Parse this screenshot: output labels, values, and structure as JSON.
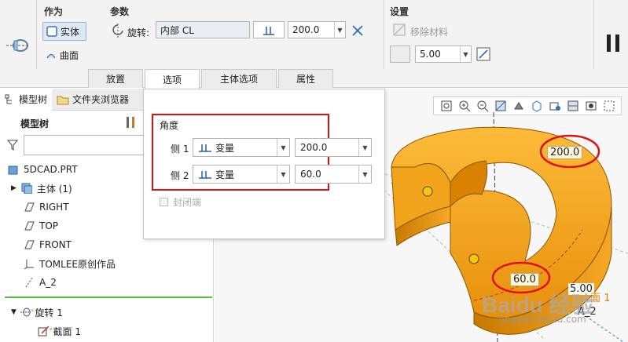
{
  "ribbon": {
    "zuowei_title": "作为",
    "shiti_label": "实体",
    "qumian_label": "曲面",
    "canshu_title": "参数",
    "xuanzhuan_label": "旋转:",
    "axis_value": "内部 CL",
    "angle_value": "200.0",
    "shezhi_title": "设置",
    "yichu_label": "移除材料",
    "thickness_value": "5.00"
  },
  "tabs": [
    "放置",
    "选项",
    "主体选项",
    "属性"
  ],
  "left_panel": {
    "tab_model_tree": "模型树",
    "tab_folder_browser": "文件夹浏览器",
    "header": "模型树",
    "search_placeholder": "",
    "items": [
      {
        "label": "5DCAD.PRT"
      },
      {
        "label": "主体 (1)"
      },
      {
        "label": "RIGHT"
      },
      {
        "label": "TOP"
      },
      {
        "label": "FRONT"
      },
      {
        "label": "TOMLEE原创作品"
      },
      {
        "label": "A_2"
      },
      {
        "label": "旋转 1"
      },
      {
        "label": "截面 1"
      }
    ]
  },
  "options_panel": {
    "title": "角度",
    "side1_label": "侧 1",
    "side1_type": "变量",
    "side1_value": "200.0",
    "side2_label": "侧 2",
    "side2_type": "变量",
    "side2_value": "60.0",
    "capped_ends_label": "封闭端"
  },
  "viewport": {
    "dim_200": "200.0",
    "dim_60": "60.0",
    "dim_5": "5.00",
    "axis_label": "A_2",
    "plane_label": "面 1",
    "watermark_brand": "Baidu 经验",
    "watermark_url": "jingyan.baidu.com"
  },
  "colors": {
    "part_orange": "#f5a623",
    "highlight_red": "#e01010",
    "tree_green": "#57b845"
  }
}
